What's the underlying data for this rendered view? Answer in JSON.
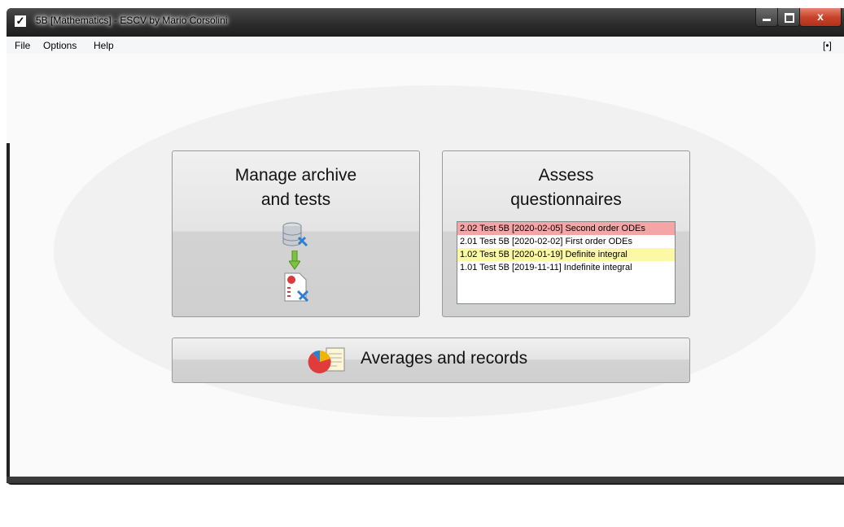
{
  "window": {
    "title": "5B [Mathematics] - ESCV by Mario Corsolini",
    "app_icon_glyph": "✓",
    "close_glyph": "x"
  },
  "menu": {
    "file": "File",
    "options": "Options",
    "help": "Help",
    "right_toggle": "[•]"
  },
  "manage_panel": {
    "title_line1": "Manage archive",
    "title_line2": "and tests"
  },
  "assess_panel": {
    "title_line1": "Assess",
    "title_line2": "questionnaires",
    "items": [
      {
        "text": "2.02 Test 5B [2020-02-05] Second order ODEs",
        "highlight": "#f4a6a6"
      },
      {
        "text": "2.01 Test 5B [2020-02-02] First order ODEs",
        "highlight": "#ffffff"
      },
      {
        "text": "1.02 Test 5B [2020-01-19] Definite integral",
        "highlight": "#fdf8a6"
      },
      {
        "text": "1.01 Test 5B [2019-11-11] Indefinite integral",
        "highlight": "#ffffff"
      }
    ]
  },
  "averages_panel": {
    "label": "Averages and records"
  },
  "icons": {
    "app": "checkmark-icon",
    "database_tools": "database-tools-icon",
    "arrow_down": "arrow-down-icon",
    "document_tools": "document-tools-icon",
    "pie_chart": "pie-chart-icon"
  },
  "colors": {
    "titlebar": "#2c2c2c",
    "close_button": "#c8432b",
    "highlight_red": "#f4a6a6",
    "highlight_yellow": "#fdf8a6"
  }
}
